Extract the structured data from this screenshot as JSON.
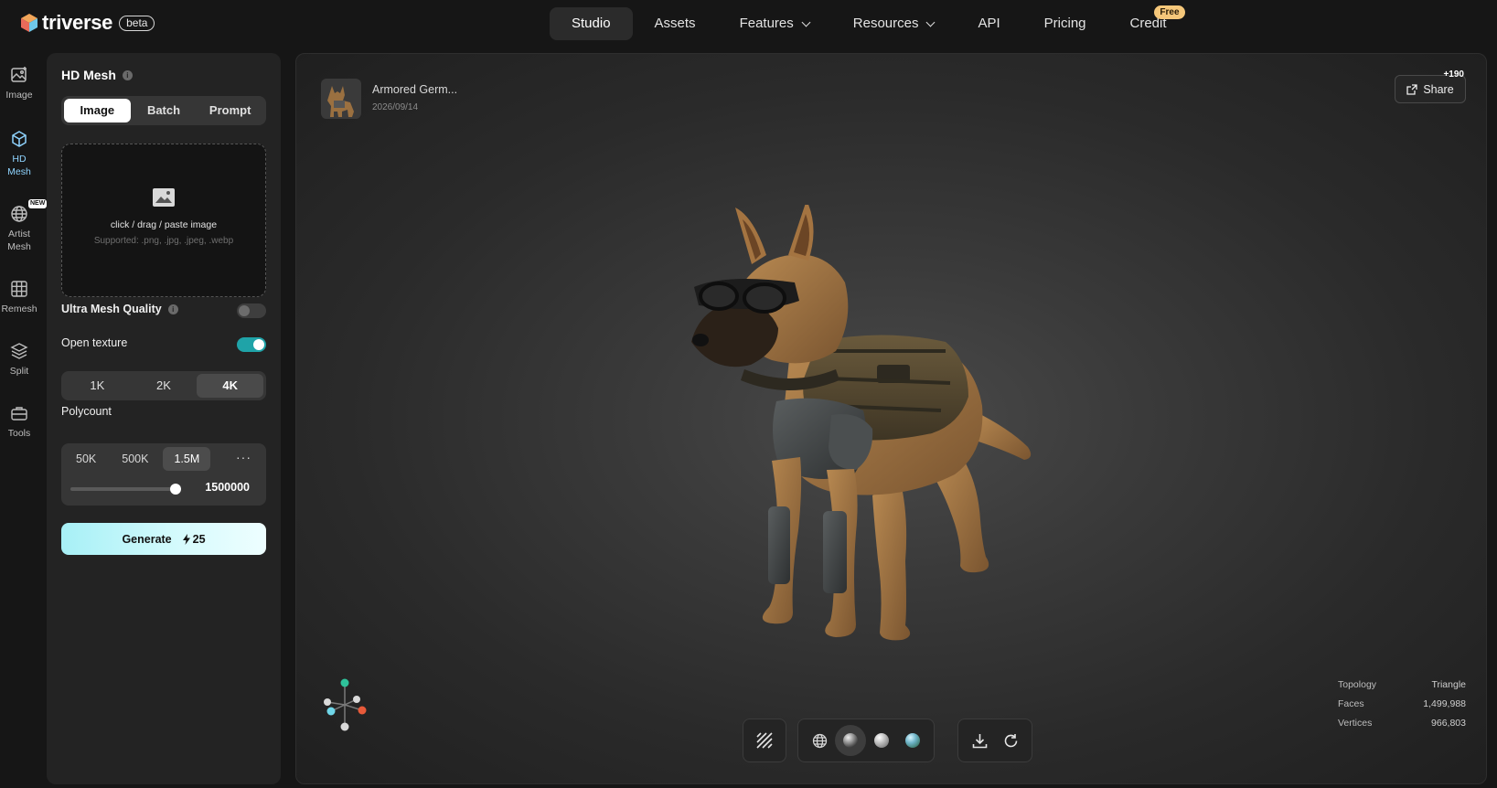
{
  "brand": {
    "name": "triverse",
    "badge": "beta"
  },
  "nav": {
    "items": [
      {
        "label": "Studio",
        "active": true,
        "dropdown": false
      },
      {
        "label": "Assets",
        "active": false,
        "dropdown": false
      },
      {
        "label": "Features",
        "active": false,
        "dropdown": true
      },
      {
        "label": "Resources",
        "active": false,
        "dropdown": true
      },
      {
        "label": "API",
        "active": false,
        "dropdown": false
      },
      {
        "label": "Pricing",
        "active": false,
        "dropdown": false
      },
      {
        "label": "Credit",
        "active": false,
        "dropdown": false,
        "badge": "Free"
      }
    ]
  },
  "rail": {
    "items": [
      {
        "label": "Image",
        "icon": "image-icon",
        "active": false
      },
      {
        "label": "HD Mesh",
        "icon": "cube-icon",
        "active": true
      },
      {
        "label": "Artist Mesh",
        "icon": "globe-mesh-icon",
        "active": false,
        "badge": "NEW"
      },
      {
        "label": "Remesh",
        "icon": "grid-icon",
        "active": false
      },
      {
        "label": "Split",
        "icon": "layers-icon",
        "active": false
      },
      {
        "label": "Tools",
        "icon": "toolbox-icon",
        "active": false
      }
    ]
  },
  "panel": {
    "title": "HD Mesh",
    "input_modes": [
      {
        "label": "Image",
        "selected": true
      },
      {
        "label": "Batch",
        "selected": false
      },
      {
        "label": "Prompt",
        "selected": false
      }
    ],
    "upload": {
      "text": "click / drag / paste image",
      "supported": "Supported: .png, .jpg, .jpeg, .webp"
    },
    "ultra_quality": {
      "label": "Ultra Mesh Quality",
      "enabled": false
    },
    "open_texture": {
      "label": "Open texture",
      "enabled": true
    },
    "texture_res": [
      {
        "label": "1K",
        "selected": false
      },
      {
        "label": "2K",
        "selected": false
      },
      {
        "label": "4K",
        "selected": true
      }
    ],
    "polycount": {
      "label": "Polycount",
      "options": [
        {
          "label": "50K",
          "selected": false
        },
        {
          "label": "500K",
          "selected": false
        },
        {
          "label": "1.5M",
          "selected": true
        }
      ],
      "more": "···",
      "value": "1500000",
      "slider_fraction": 0.98
    },
    "generate": {
      "label": "Generate",
      "cost": "25"
    }
  },
  "viewer": {
    "asset": {
      "name": "Armored Germ...",
      "date": "2026/09/14"
    },
    "share": {
      "label": "Share",
      "count": "+190"
    },
    "stats": [
      {
        "key": "Topology",
        "value": "Triangle"
      },
      {
        "key": "Faces",
        "value": "1,499,988"
      },
      {
        "key": "Vertices",
        "value": "966,803"
      }
    ],
    "toolbar": {
      "texture_toggle": "pattern-icon",
      "modes": [
        "wireframe-globe-icon",
        "shaded-sphere-icon",
        "clay-sphere-icon",
        "textured-sphere-icon"
      ],
      "actions": [
        "download-icon",
        "refresh-icon"
      ]
    },
    "colors": {
      "accent": "#1fa3a8",
      "generate": "#a7f0f6",
      "free_badge": "#f5c77a"
    }
  }
}
